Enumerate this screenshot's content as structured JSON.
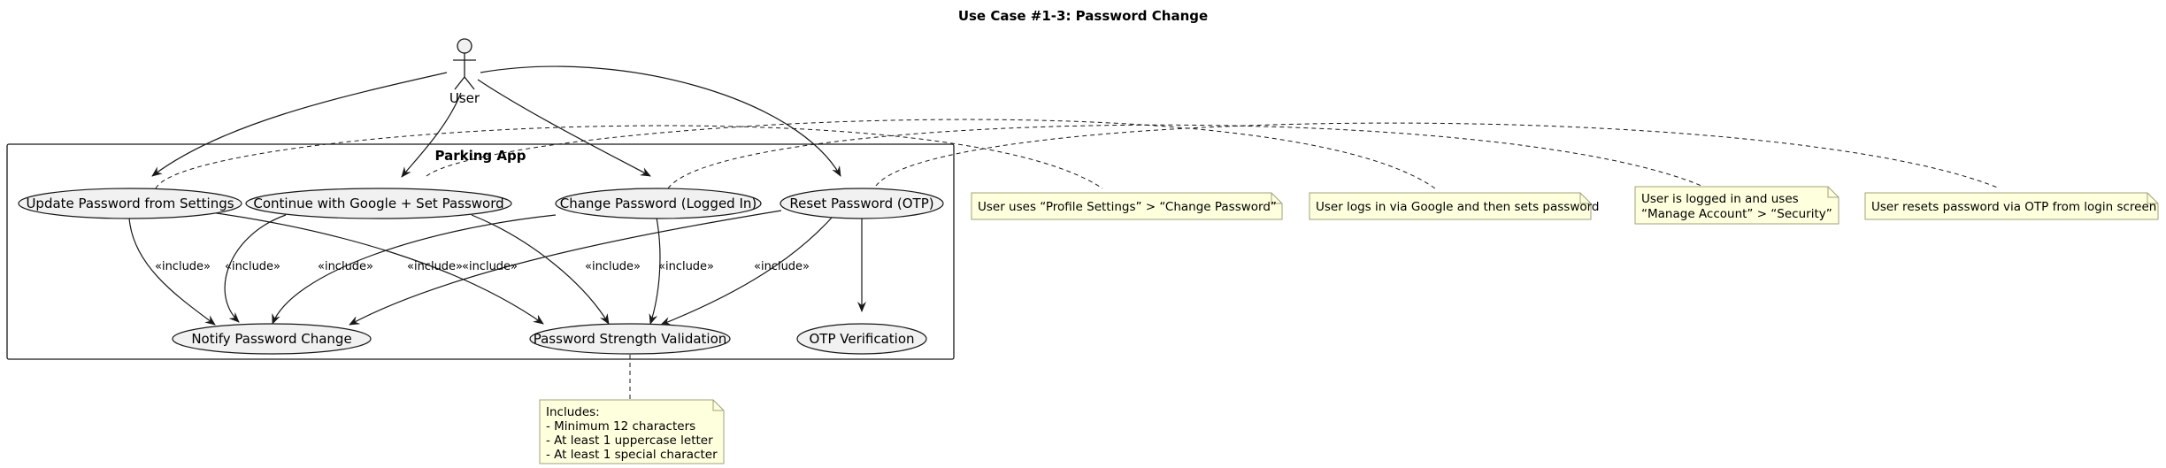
{
  "title": "Use Case #1-3: Password Change",
  "actor": {
    "name": "User"
  },
  "system": {
    "name": "Parking App"
  },
  "use_cases": {
    "update_settings": "Update Password from Settings",
    "google_set": "Continue with Google + Set Password",
    "change_logged_in": "Change Password (Logged In)",
    "reset_otp": "Reset Password (OTP)",
    "notify_change": "Notify Password Change",
    "strength_validation": "Password Strength Validation",
    "otp_verification": "OTP Verification"
  },
  "relation_label": "«include»",
  "notes": {
    "settings": [
      "User uses “Profile Settings” > “Change Password”"
    ],
    "google": [
      "User logs in via Google and then sets password"
    ],
    "logged_in": [
      "User is logged in and uses",
      "“Manage Account” > “Security”"
    ],
    "otp": [
      "User resets password via OTP from login screen"
    ],
    "validation": [
      "Includes:",
      "- Minimum 12 characters",
      "- At least 1 uppercase letter",
      "- At least 1 special character"
    ]
  },
  "colors": {
    "usecase_fill": "#F1F1F1",
    "note_fill": "#FEFFDD",
    "note_border": "#A0A07A",
    "line": "#181818"
  }
}
